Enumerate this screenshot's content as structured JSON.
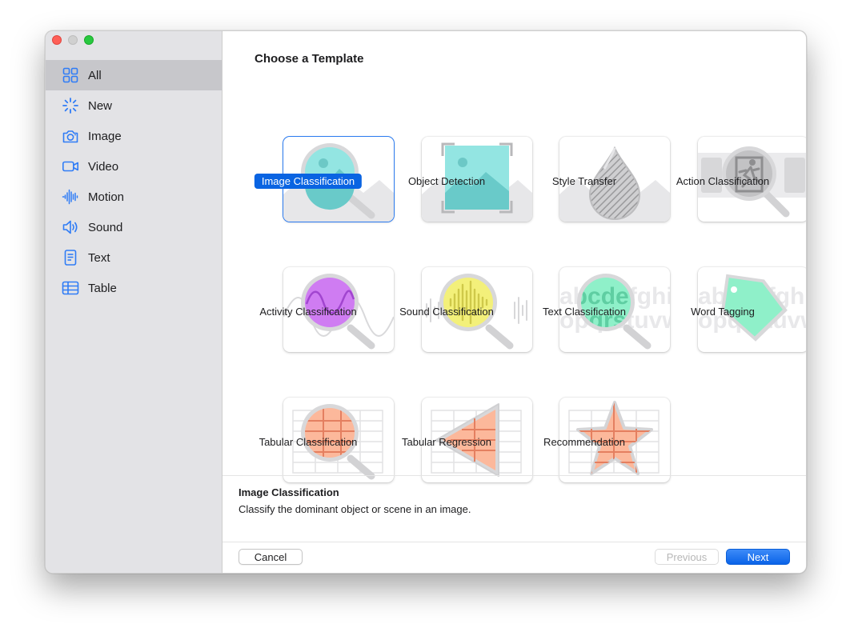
{
  "sidebar": {
    "items": [
      {
        "label": "All",
        "icon": "grid-icon"
      },
      {
        "label": "New",
        "icon": "sparkle-icon"
      },
      {
        "label": "Image",
        "icon": "camera-icon"
      },
      {
        "label": "Video",
        "icon": "video-camera-icon"
      },
      {
        "label": "Motion",
        "icon": "waveform-icon"
      },
      {
        "label": "Sound",
        "icon": "speaker-icon"
      },
      {
        "label": "Text",
        "icon": "document-icon"
      },
      {
        "label": "Table",
        "icon": "table-icon"
      }
    ],
    "selected": "All"
  },
  "main": {
    "title": "Choose a Template",
    "templates": [
      {
        "label": "Image Classification",
        "selected": true
      },
      {
        "label": "Object Detection"
      },
      {
        "label": "Style Transfer"
      },
      {
        "label": "Action Classification"
      },
      {
        "label": "Activity Classification"
      },
      {
        "label": "Sound Classification"
      },
      {
        "label": "Text Classification"
      },
      {
        "label": "Word Tagging"
      },
      {
        "label": "Tabular Classification"
      },
      {
        "label": "Tabular Regression"
      },
      {
        "label": "Recommendation"
      }
    ],
    "thumb_text": {
      "row1": "abcdefghi",
      "row2": "opqrstuvw"
    }
  },
  "description": {
    "title": "Image Classification",
    "text": "Classify the dominant object or scene in an image."
  },
  "footer": {
    "cancel": "Cancel",
    "previous": "Previous",
    "next": "Next"
  },
  "colors": {
    "accent": "#0a64e2",
    "sidebar_icon": "#2f7cf6",
    "sidebar_bg": "#e3e3e6"
  }
}
